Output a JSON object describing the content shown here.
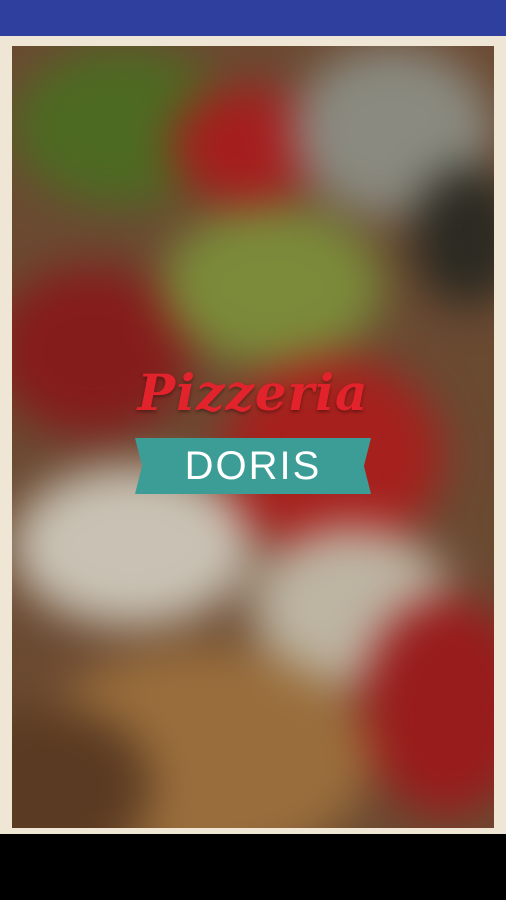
{
  "splash": {
    "logo_title": "Pizzeria",
    "logo_subtitle": "DORIS"
  },
  "colors": {
    "status_bar": "#2f3f9e",
    "logo_red": "#e3232c",
    "ribbon_teal": "#3c9c96",
    "frame": "#efe6d6"
  }
}
